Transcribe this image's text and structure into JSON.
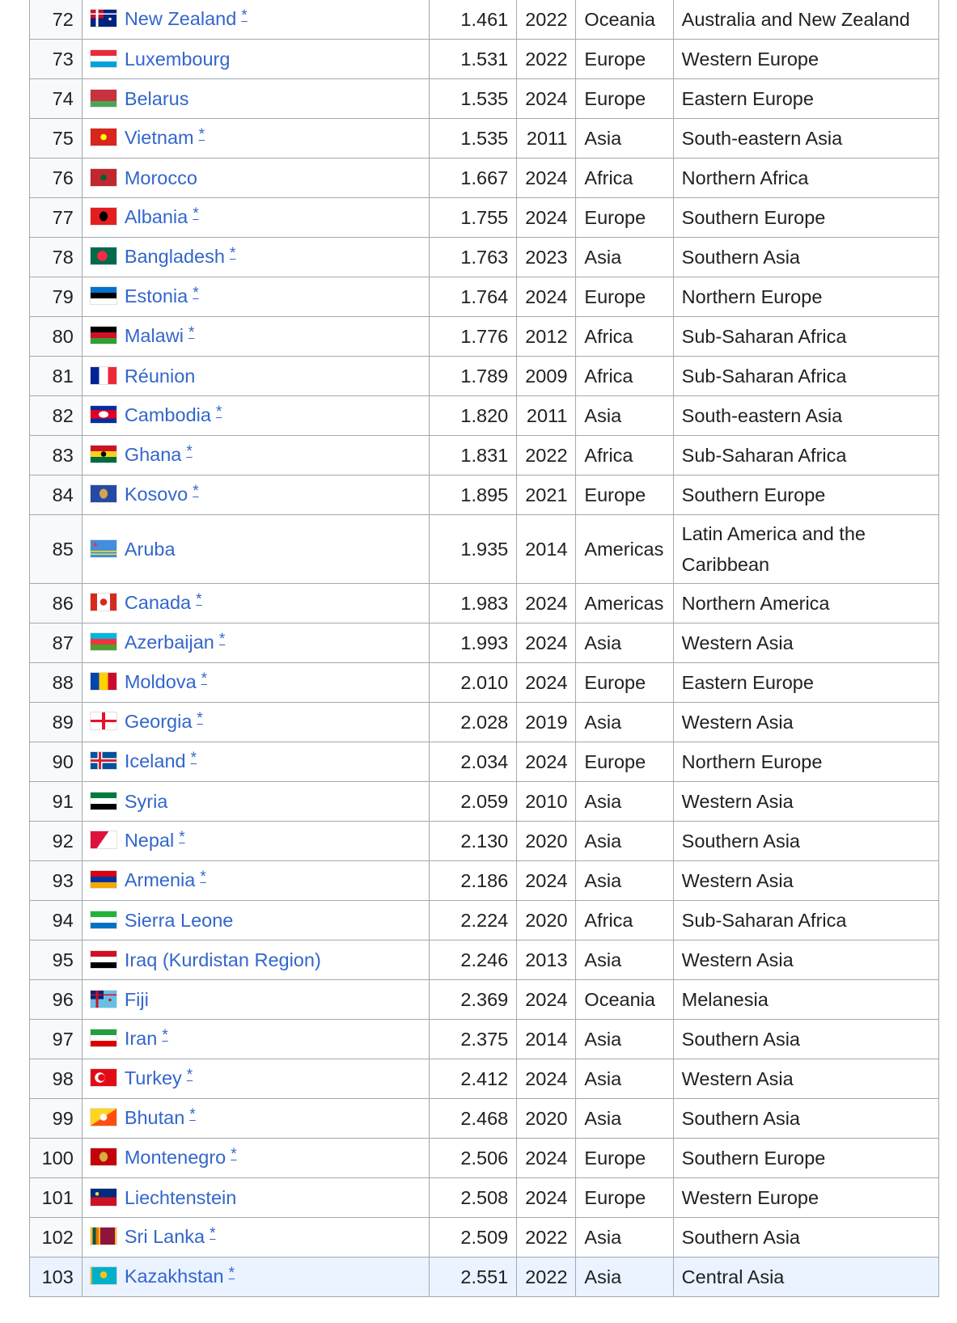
{
  "rows": [
    {
      "rank": "72",
      "country": "New Zealand",
      "star": true,
      "value": "1.461",
      "year": "2022",
      "region": "Oceania",
      "subregion": "Australia and New Zealand",
      "flag_icon": "new-zealand-flag-icon",
      "flag_colors": [
        "#00247d",
        "#c8102e",
        "#ffffff"
      ],
      "flag_pattern": "canton"
    },
    {
      "rank": "73",
      "country": "Luxembourg",
      "star": false,
      "value": "1.531",
      "year": "2022",
      "region": "Europe",
      "subregion": "Western Europe",
      "flag_icon": "luxembourg-flag-icon",
      "flag_colors": [
        "#ed2939",
        "#ffffff",
        "#00a1de"
      ],
      "flag_pattern": "h3"
    },
    {
      "rank": "74",
      "country": "Belarus",
      "star": false,
      "value": "1.535",
      "year": "2024",
      "region": "Europe",
      "subregion": "Eastern Europe",
      "flag_icon": "belarus-flag-icon",
      "flag_colors": [
        "#c8313e",
        "#4aa657",
        "#ffffff"
      ],
      "flag_pattern": "belarus"
    },
    {
      "rank": "75",
      "country": "Vietnam",
      "star": true,
      "value": "1.535",
      "year": "2011",
      "region": "Asia",
      "subregion": "South-eastern Asia",
      "flag_icon": "vietnam-flag-icon",
      "flag_colors": [
        "#da251d",
        "#ffff00"
      ],
      "flag_pattern": "star"
    },
    {
      "rank": "76",
      "country": "Morocco",
      "star": false,
      "value": "1.667",
      "year": "2024",
      "region": "Africa",
      "subregion": "Northern Africa",
      "flag_icon": "morocco-flag-icon",
      "flag_colors": [
        "#c1272d",
        "#006233"
      ],
      "flag_pattern": "star"
    },
    {
      "rank": "77",
      "country": "Albania",
      "star": true,
      "value": "1.755",
      "year": "2024",
      "region": "Europe",
      "subregion": "Southern Europe",
      "flag_icon": "albania-flag-icon",
      "flag_colors": [
        "#e41e20",
        "#000000"
      ],
      "flag_pattern": "emblem"
    },
    {
      "rank": "78",
      "country": "Bangladesh",
      "star": true,
      "value": "1.763",
      "year": "2023",
      "region": "Asia",
      "subregion": "Southern Asia",
      "flag_icon": "bangladesh-flag-icon",
      "flag_colors": [
        "#006a4e",
        "#f42a41"
      ],
      "flag_pattern": "disc"
    },
    {
      "rank": "79",
      "country": "Estonia",
      "star": true,
      "value": "1.764",
      "year": "2024",
      "region": "Europe",
      "subregion": "Northern Europe",
      "flag_icon": "estonia-flag-icon",
      "flag_colors": [
        "#0072ce",
        "#000000",
        "#ffffff"
      ],
      "flag_pattern": "h3"
    },
    {
      "rank": "80",
      "country": "Malawi",
      "star": true,
      "value": "1.776",
      "year": "2012",
      "region": "Africa",
      "subregion": "Sub-Saharan Africa",
      "flag_icon": "malawi-flag-icon",
      "flag_colors": [
        "#000000",
        "#ce1126",
        "#339e35"
      ],
      "flag_pattern": "h3"
    },
    {
      "rank": "81",
      "country": "Réunion",
      "star": false,
      "value": "1.789",
      "year": "2009",
      "region": "Africa",
      "subregion": "Sub-Saharan Africa",
      "flag_icon": "reunion-flag-icon",
      "flag_colors": [
        "#002395",
        "#ffffff",
        "#ed2939"
      ],
      "flag_pattern": "v3"
    },
    {
      "rank": "82",
      "country": "Cambodia",
      "star": true,
      "value": "1.820",
      "year": "2011",
      "region": "Asia",
      "subregion": "South-eastern Asia",
      "flag_icon": "cambodia-flag-icon",
      "flag_colors": [
        "#032ea1",
        "#e00025",
        "#ffffff"
      ],
      "flag_pattern": "cambodia"
    },
    {
      "rank": "83",
      "country": "Ghana",
      "star": true,
      "value": "1.831",
      "year": "2022",
      "region": "Africa",
      "subregion": "Sub-Saharan Africa",
      "flag_icon": "ghana-flag-icon",
      "flag_colors": [
        "#ce1126",
        "#fcd116",
        "#006b3f"
      ],
      "flag_pattern": "h3star"
    },
    {
      "rank": "84",
      "country": "Kosovo",
      "star": true,
      "value": "1.895",
      "year": "2021",
      "region": "Europe",
      "subregion": "Southern Europe",
      "flag_icon": "kosovo-flag-icon",
      "flag_colors": [
        "#244aa5",
        "#d0a650"
      ],
      "flag_pattern": "emblem"
    },
    {
      "rank": "85",
      "country": "Aruba",
      "star": false,
      "value": "1.935",
      "year": "2014",
      "region": "Americas",
      "subregion": "Latin America and the Caribbean",
      "flag_icon": "aruba-flag-icon",
      "flag_colors": [
        "#418fde",
        "#fbe122"
      ],
      "flag_pattern": "aruba",
      "tall": true
    },
    {
      "rank": "86",
      "country": "Canada",
      "star": true,
      "value": "1.983",
      "year": "2024",
      "region": "Americas",
      "subregion": "Northern America",
      "flag_icon": "canada-flag-icon",
      "flag_colors": [
        "#d52b1e",
        "#ffffff"
      ],
      "flag_pattern": "canada"
    },
    {
      "rank": "87",
      "country": "Azerbaijan",
      "star": true,
      "value": "1.993",
      "year": "2024",
      "region": "Asia",
      "subregion": "Western Asia",
      "flag_icon": "azerbaijan-flag-icon",
      "flag_colors": [
        "#00b5e2",
        "#ef3340",
        "#509e2f"
      ],
      "flag_pattern": "h3"
    },
    {
      "rank": "88",
      "country": "Moldova",
      "star": true,
      "value": "2.010",
      "year": "2024",
      "region": "Europe",
      "subregion": "Eastern Europe",
      "flag_icon": "moldova-flag-icon",
      "flag_colors": [
        "#0046ae",
        "#ffd200",
        "#cc092f"
      ],
      "flag_pattern": "v3"
    },
    {
      "rank": "89",
      "country": "Georgia",
      "star": true,
      "value": "2.028",
      "year": "2019",
      "region": "Asia",
      "subregion": "Western Asia",
      "flag_icon": "georgia-flag-icon",
      "flag_colors": [
        "#ffffff",
        "#e8112d"
      ],
      "flag_pattern": "cross"
    },
    {
      "rank": "90",
      "country": "Iceland",
      "star": true,
      "value": "2.034",
      "year": "2024",
      "region": "Europe",
      "subregion": "Northern Europe",
      "flag_icon": "iceland-flag-icon",
      "flag_colors": [
        "#02529c",
        "#dc1e35",
        "#ffffff"
      ],
      "flag_pattern": "nordic"
    },
    {
      "rank": "91",
      "country": "Syria",
      "star": false,
      "value": "2.059",
      "year": "2010",
      "region": "Asia",
      "subregion": "Western Asia",
      "flag_icon": "syria-flag-icon",
      "flag_colors": [
        "#007a3d",
        "#ffffff",
        "#000000"
      ],
      "flag_pattern": "h3"
    },
    {
      "rank": "92",
      "country": "Nepal",
      "star": true,
      "value": "2.130",
      "year": "2020",
      "region": "Asia",
      "subregion": "Southern Asia",
      "flag_icon": "nepal-flag-icon",
      "flag_colors": [
        "#dc143c",
        "#003893"
      ],
      "flag_pattern": "nepal"
    },
    {
      "rank": "93",
      "country": "Armenia",
      "star": true,
      "value": "2.186",
      "year": "2024",
      "region": "Asia",
      "subregion": "Western Asia",
      "flag_icon": "armenia-flag-icon",
      "flag_colors": [
        "#d90012",
        "#0033a0",
        "#f2a800"
      ],
      "flag_pattern": "h3"
    },
    {
      "rank": "94",
      "country": "Sierra Leone",
      "star": false,
      "value": "2.224",
      "year": "2020",
      "region": "Africa",
      "subregion": "Sub-Saharan Africa",
      "flag_icon": "sierra-leone-flag-icon",
      "flag_colors": [
        "#1eb53a",
        "#ffffff",
        "#0072c6"
      ],
      "flag_pattern": "h3"
    },
    {
      "rank": "95",
      "country": "Iraq (Kurdistan Region)",
      "star": false,
      "value": "2.246",
      "year": "2013",
      "region": "Asia",
      "subregion": "Western Asia",
      "flag_icon": "iraq-flag-icon",
      "flag_colors": [
        "#ce1126",
        "#ffffff",
        "#000000"
      ],
      "flag_pattern": "h3"
    },
    {
      "rank": "96",
      "country": "Fiji",
      "star": false,
      "value": "2.369",
      "year": "2024",
      "region": "Oceania",
      "subregion": "Melanesia",
      "flag_icon": "fiji-flag-icon",
      "flag_colors": [
        "#68bfe5",
        "#00247d",
        "#ce1126"
      ],
      "flag_pattern": "canton"
    },
    {
      "rank": "97",
      "country": "Iran",
      "star": true,
      "value": "2.375",
      "year": "2014",
      "region": "Asia",
      "subregion": "Southern Asia",
      "flag_icon": "iran-flag-icon",
      "flag_colors": [
        "#239f40",
        "#ffffff",
        "#da0000"
      ],
      "flag_pattern": "h3"
    },
    {
      "rank": "98",
      "country": "Turkey",
      "star": true,
      "value": "2.412",
      "year": "2024",
      "region": "Asia",
      "subregion": "Western Asia",
      "flag_icon": "turkey-flag-icon",
      "flag_colors": [
        "#e30a17",
        "#ffffff"
      ],
      "flag_pattern": "crescent"
    },
    {
      "rank": "99",
      "country": "Bhutan",
      "star": true,
      "value": "2.468",
      "year": "2020",
      "region": "Asia",
      "subregion": "Southern Asia",
      "flag_icon": "bhutan-flag-icon",
      "flag_colors": [
        "#ffd520",
        "#ff4e12",
        "#ffffff"
      ],
      "flag_pattern": "diag"
    },
    {
      "rank": "100",
      "country": "Montenegro",
      "star": true,
      "value": "2.506",
      "year": "2024",
      "region": "Europe",
      "subregion": "Southern Europe",
      "flag_icon": "montenegro-flag-icon",
      "flag_colors": [
        "#c40308",
        "#d4af3a"
      ],
      "flag_pattern": "emblem"
    },
    {
      "rank": "101",
      "country": "Liechtenstein",
      "star": false,
      "value": "2.508",
      "year": "2024",
      "region": "Europe",
      "subregion": "Western Europe",
      "flag_icon": "liechtenstein-flag-icon",
      "flag_colors": [
        "#002b7f",
        "#ce1126",
        "#ffd83d"
      ],
      "flag_pattern": "h2crown"
    },
    {
      "rank": "102",
      "country": "Sri Lanka",
      "star": true,
      "value": "2.509",
      "year": "2022",
      "region": "Asia",
      "subregion": "Southern Asia",
      "flag_icon": "sri-lanka-flag-icon",
      "flag_colors": [
        "#ffbe29",
        "#8d153a",
        "#00534e",
        "#eb7400"
      ],
      "flag_pattern": "srilanka"
    },
    {
      "rank": "103",
      "country": "Kazakhstan",
      "star": true,
      "value": "2.551",
      "year": "2022",
      "region": "Asia",
      "subregion": "Central Asia",
      "flag_icon": "kazakhstan-flag-icon",
      "flag_colors": [
        "#00afca",
        "#fec50c"
      ],
      "flag_pattern": "sun",
      "highlight": true
    }
  ],
  "note_marker": "*",
  "link_color": "#3366cc",
  "border_color": "#a2a9b1",
  "highlight_color": "#eaf3ff"
}
